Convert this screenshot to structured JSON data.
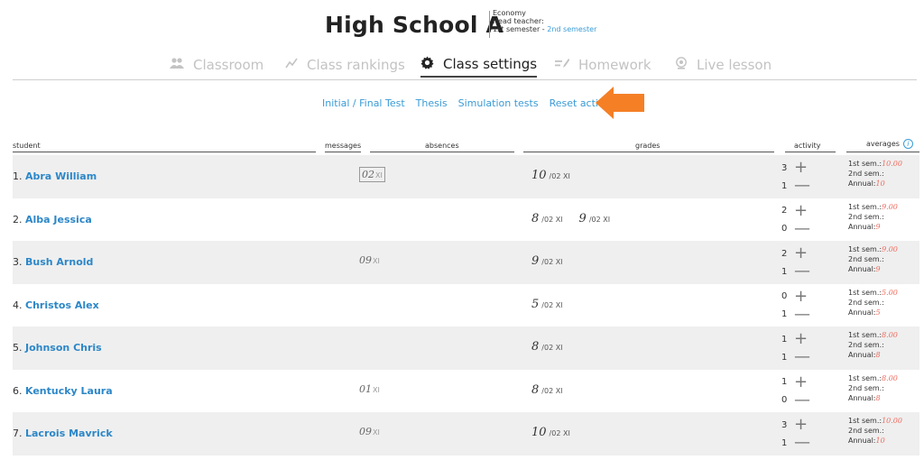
{
  "school": {
    "name": "High School A",
    "subject": "Economy",
    "head_teacher": "Head teacher:",
    "semester1": "1st semester",
    "semester_sep": " - ",
    "semester2": "2nd semester"
  },
  "tabs": [
    {
      "label": "Classroom",
      "icon": "users-icon"
    },
    {
      "label": "Class rankings",
      "icon": "trend-icon"
    },
    {
      "label": "Class settings",
      "icon": "gear-icon"
    },
    {
      "label": "Homework",
      "icon": "pencil-icon"
    },
    {
      "label": "Live lesson",
      "icon": "webcam-icon"
    }
  ],
  "sublinks": [
    "Initial / Final Test",
    "Thesis",
    "Simulation tests",
    "Reset activity"
  ],
  "table_headers": {
    "student": "student",
    "messages": "messages",
    "absences": "absences",
    "grades": "grades",
    "activity": "activity",
    "averages": "averages",
    "info": "i"
  },
  "labels": {
    "sem1": "1st sem.:",
    "sem2": "2nd sem.:",
    "annual": "Annual:",
    "plus": "+",
    "minus": "—"
  },
  "students": [
    {
      "index": "1.",
      "name": "Abra William",
      "absence": "02",
      "absence_mon": "XI",
      "grades": [
        {
          "value": "10",
          "date": "/02 XI"
        }
      ],
      "act_plus": "3",
      "act_minus": "1",
      "sem1": "10.00",
      "sem2": "",
      "annual": "10"
    },
    {
      "index": "2.",
      "name": "Alba Jessica",
      "absence": "",
      "absence_mon": "",
      "grades": [
        {
          "value": "8",
          "date": "/02 XI"
        },
        {
          "value": "9",
          "date": "/02 XI"
        }
      ],
      "act_plus": "2",
      "act_minus": "0",
      "sem1": "9.00",
      "sem2": "",
      "annual": "9"
    },
    {
      "index": "3.",
      "name": "Bush Arnold",
      "absence": "09",
      "absence_mon": "XI",
      "grades": [
        {
          "value": "9",
          "date": "/02 XI"
        }
      ],
      "act_plus": "2",
      "act_minus": "1",
      "sem1": "9.00",
      "sem2": "",
      "annual": "9"
    },
    {
      "index": "4.",
      "name": "Christos Alex",
      "absence": "",
      "absence_mon": "",
      "grades": [
        {
          "value": "5",
          "date": "/02 XI"
        }
      ],
      "act_plus": "0",
      "act_minus": "1",
      "sem1": "5.00",
      "sem2": "",
      "annual": "5"
    },
    {
      "index": "5.",
      "name": "Johnson Chris",
      "absence": "",
      "absence_mon": "",
      "grades": [
        {
          "value": "8",
          "date": "/02 XI"
        }
      ],
      "act_plus": "1",
      "act_minus": "1",
      "sem1": "8.00",
      "sem2": "",
      "annual": "8"
    },
    {
      "index": "6.",
      "name": "Kentucky Laura",
      "absence": "01",
      "absence_mon": "XI",
      "grades": [
        {
          "value": "8",
          "date": "/02 XI"
        }
      ],
      "act_plus": "1",
      "act_minus": "0",
      "sem1": "8.00",
      "sem2": "",
      "annual": "8"
    },
    {
      "index": "7.",
      "name": "Lacrois Mavrick",
      "absence": "09",
      "absence_mon": "XI",
      "grades": [
        {
          "value": "10",
          "date": "/02 XI"
        }
      ],
      "act_plus": "3",
      "act_minus": "1",
      "sem1": "10.00",
      "sem2": "",
      "annual": "10"
    }
  ],
  "colors": {
    "link": "#3a9bd6",
    "average_value": "#f06b5e",
    "arrow": "#f57f25"
  }
}
